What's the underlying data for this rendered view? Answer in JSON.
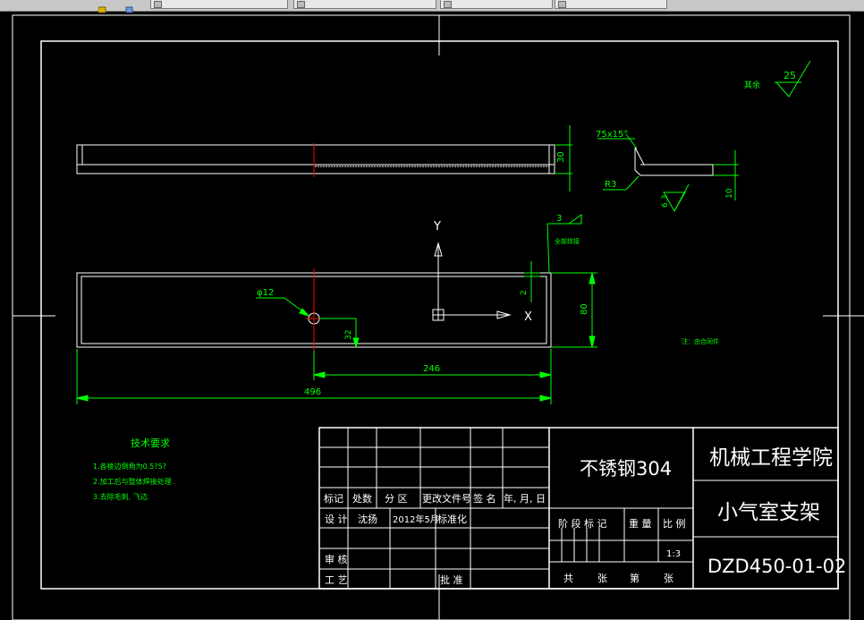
{
  "tabs": [
    {
      "label": ""
    },
    {
      "label": ""
    },
    {
      "label": ""
    },
    {
      "label": ""
    },
    {
      "label": ""
    }
  ],
  "drawing": {
    "axis_y": "Y",
    "axis_x": "X",
    "dim_total": "496",
    "dim_246": "246",
    "dim_80": "80",
    "dim_30": "30",
    "dim_32": "32",
    "dim_2": "2",
    "dim_10": "10",
    "dim_63": "6.3",
    "hole_label": "φ12",
    "chamfer_label": "75x15°",
    "radius_label": "R3",
    "weld_size": "3",
    "weld_note": "全部焊接",
    "surface_value": "25",
    "surface_rest": "其余",
    "note_right": "注：由合同件",
    "tech_title": "技术要求",
    "tech_items": [
      "1.各棱边倒角为0.5?5?",
      "2.加工后与整体焊接处理.",
      "3.去除毛刺, 飞边."
    ]
  },
  "title_block": {
    "material": "不锈钢304",
    "school": "机械工程学院",
    "part_name": "小气室支架",
    "drawing_no": "DZD450-01-02",
    "rev_headers": [
      "标记",
      "处数",
      "分 区",
      "更改文件号",
      "签 名",
      "年, 月, 日"
    ],
    "design_label": "设 计",
    "designer": "沈扬",
    "design_date": "2012年5月",
    "standardize": "标准化",
    "stage_label": "阶 段 标 记",
    "weight_label": "重 量",
    "scale_label": "比 例",
    "scale_value": "1:3",
    "review_label": "审 核",
    "process_label": "工 艺",
    "approve_label": "批 准",
    "total_label": "共",
    "sheet_label": "张",
    "page_label": "第",
    "sheet_label2": "张"
  },
  "colors": {
    "background": "#000000",
    "geometry": "#ffffff",
    "dimension": "#00ff00",
    "centerline": "#ff0000"
  }
}
